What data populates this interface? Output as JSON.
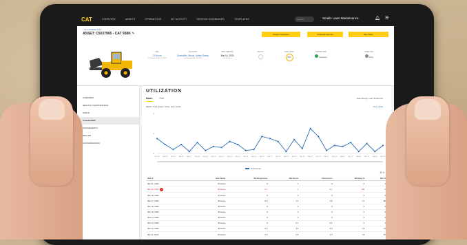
{
  "nav": {
    "logo": "CAT",
    "items": [
      "OVERVIEW",
      "ASSETS",
      "OPERATIONS",
      "MY ACTIVITY",
      "SERVICE DASHBOARD",
      "TEMPLATES"
    ],
    "search_placeholder": "Search...",
    "company": "Smalls Lawn Maintenance"
  },
  "asset": {
    "breadcrumb": "< ALL ASSETS LIST",
    "name": "ASSET: C5037965 - CAT 938K",
    "buttons": {
      "inspection": "Assign Inspection",
      "service": "Schedule Service",
      "parts": "Buy Parts"
    },
    "stats": [
      {
        "label": "SMU",
        "value": "13 Hours",
        "sub": "Last Reported Mar 14, 2023"
      },
      {
        "label": "LOCATION",
        "value": "Greenville, Illinois, United States",
        "sub": "Last Updated Mar 14, 2023"
      },
      {
        "label": "NEXT SERVICE",
        "value": "Mar 14, 2023",
        "sub": "875.13 Hours"
      },
      {
        "label": "FAULTS",
        "value": "—",
        "sub": ""
      },
      {
        "label": "FUEL LEVEL",
        "value": "92%",
        "sub": ""
      },
      {
        "label": "CONNECTION",
        "value": "Connected",
        "sub": ""
      },
      {
        "label": "ASSET KEY",
        "value": "Active",
        "sub": ""
      }
    ]
  },
  "sidebar": {
    "items": [
      "OVERVIEW",
      "HEALTH & MAINTENANCE",
      "PARTS",
      "UTILIZATION",
      "ASSIGNMENTS",
      "DEALER",
      "CUSTOMISATION"
    ],
    "active_index": 3
  },
  "main": {
    "title": "UTILIZATION",
    "tabs": [
      "Hours",
      "Fuel"
    ],
    "active_tab": 0,
    "sort_by": "Date Range: Last 30 Months",
    "filters": "Metric: Total Hours  •  View: Hour Chart",
    "view_detail": "View detail",
    "legend": "Total Hours"
  },
  "chart_data": {
    "type": "line",
    "x": [
      "Mar 03",
      "Mar 04",
      "Mar 05",
      "Mar 06",
      "Mar 07",
      "Mar 08",
      "Mar 09",
      "Mar 10",
      "Mar 11",
      "Mar 12",
      "Mar 13",
      "Mar 14",
      "Mar 15",
      "Mar 16",
      "Mar 17",
      "Mar 18",
      "Mar 19",
      "Mar 20",
      "Mar 21",
      "Mar 22",
      "Mar 23",
      "Mar 24",
      "Mar 25",
      "Mar 26",
      "Mar 27",
      "Mar 28",
      "Mar 29",
      "Mar 30",
      "Mar 31"
    ],
    "series": [
      {
        "name": "Total Hours",
        "values": [
          1.5,
          0.9,
          0.4,
          0.9,
          0.2,
          1.1,
          0.3,
          0.7,
          0.6,
          1.2,
          0.9,
          0.3,
          0.4,
          1.7,
          1.5,
          1.2,
          0.2,
          1.4,
          0.5,
          2.5,
          1.7,
          0.3,
          0.8,
          0.7,
          1.1,
          0.2,
          1.0,
          0.2,
          0.8
        ]
      }
    ],
    "ylim": [
      0,
      4
    ],
    "yticks": [
      0,
      2,
      4
    ],
    "grid": false,
    "legend_position": "bottom-center"
  },
  "table": {
    "columns": [
      "Date",
      "Hour Meter",
      "Working Hours",
      "Idle Hours",
      "Total Hours",
      "Working %",
      "Idle %"
    ],
    "rows": [
      [
        "Mar 21, 2023",
        "20 Hours",
        "0",
        "1",
        "0",
        "0",
        "1"
      ],
      [
        "Mar 20, 2023",
        "20 Hours",
        "0.1",
        "1",
        "0.1",
        "100",
        "0"
      ],
      [
        "Mar 19, 2023",
        "21 Hours",
        "0",
        "0",
        "0",
        "0",
        "0"
      ],
      [
        "Mar 17, 2023",
        "20 Hours",
        "0.5",
        "1.1",
        "1.6",
        "17",
        "83"
      ],
      [
        "Mar 16, 2023",
        "20 Hours",
        "0",
        "0",
        "0",
        "0",
        "0"
      ],
      [
        "Mar 15, 2023",
        "20 Hours",
        "0",
        "0",
        "0",
        "0",
        "0"
      ],
      [
        "Mar 14, 2023",
        "20 Hours",
        "0",
        "0",
        "0",
        "0",
        "0"
      ],
      [
        "Mar 13, 2023",
        "20 Hours",
        "0",
        "0.1",
        "0.1",
        "0",
        "1"
      ],
      [
        "Mar 12, 2023",
        "20 Hours",
        "0.6",
        "3.6",
        "4.2",
        "13",
        "14"
      ],
      [
        "Mar 11, 2023",
        "20 Hours",
        "0.5",
        "0.5",
        "1.0",
        "13",
        "87"
      ]
    ],
    "alert_row": 1
  },
  "colors": {
    "accent": "#ffcd11",
    "line": "#2f6db5",
    "alert": "#d32f2f"
  }
}
